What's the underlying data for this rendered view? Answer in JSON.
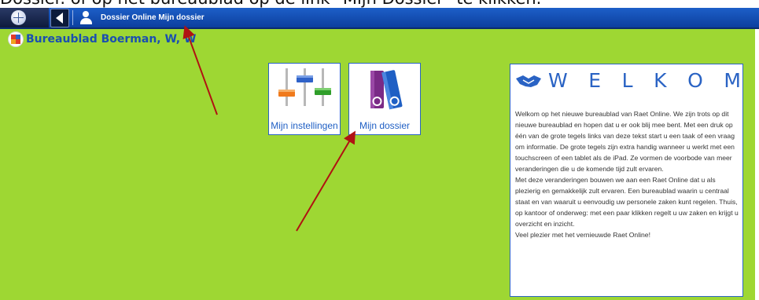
{
  "caption": "Dossier. of op het bureaublad op de link \"Mijn Dossier\" te klikken.",
  "topbar": {
    "title": "Dossier Online Mijn dossier"
  },
  "desktop": {
    "title": "Bureaublad  Boerman, W, W"
  },
  "tiles": [
    {
      "label": "Mijn instellingen",
      "icon": "sliders-icon"
    },
    {
      "label": "Mijn dossier",
      "icon": "binders-icon"
    }
  ],
  "welcome": {
    "title_letters": [
      "W",
      "E",
      "L",
      "K",
      "O",
      "M"
    ],
    "paragraph1": "Welkom op het nieuwe bureaublad van Raet Online. We zijn trots op dit nieuwe bureaublad en hopen dat u er ook blij mee bent. Met een druk op één van de grote tegels links van deze tekst start u een taak of een vraag om informatie. De grote tegels zijn extra handig wanneer u werkt met een touchscreen of een tablet als de iPad. Ze vormen de voorbode van meer veranderingen die u de komende tijd zult ervaren.",
    "paragraph2": "Met deze veranderingen bouwen we aan een Raet Online dat u als plezierig en gemakkelijk zult ervaren. Een bureaublad waarin u centraal staat en van waaruit u eenvoudig uw personele zaken kunt regelen. Thuis, op kantoor of onderweg: met een paar klikken regelt u uw zaken en krijgt u overzicht en inzicht.",
    "paragraph3": "Veel plezier met het vernieuwde Raet Online!"
  },
  "colors": {
    "background": "#9ed733",
    "nav": "#1d5fc8",
    "accent": "#2a63c4",
    "annotation": "#b01212"
  }
}
